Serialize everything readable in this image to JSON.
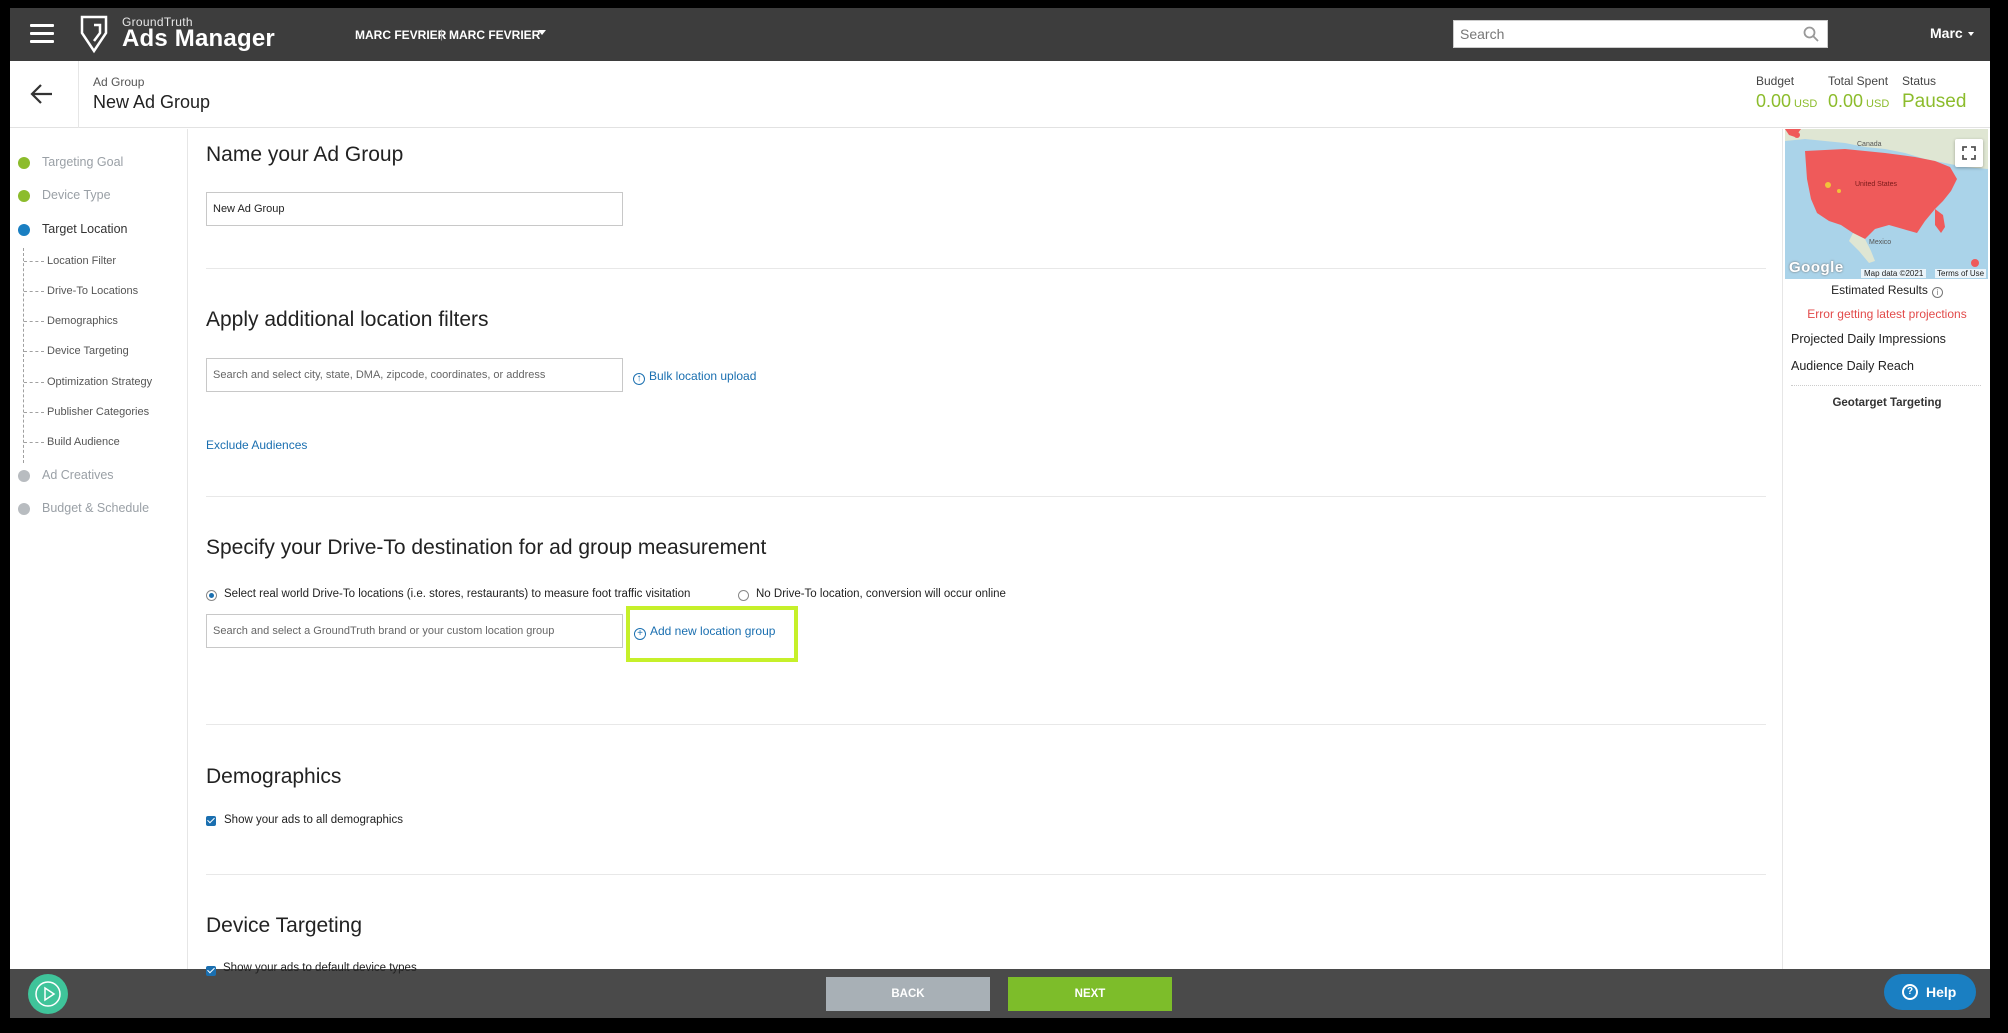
{
  "header": {
    "brand_small": "GroundTruth",
    "brand_main": "Ads Manager",
    "account_primary": "MARC FEVRIER",
    "account_secondary": "MARC FEVRIER",
    "search_placeholder": "Search",
    "user": "Marc"
  },
  "subheader": {
    "crumb": "Ad Group",
    "title": "New Ad Group",
    "budget_label": "Budget",
    "budget_value": "0.00",
    "budget_unit": "USD",
    "spent_label": "Total Spent",
    "spent_value": "0.00",
    "spent_unit": "USD",
    "status_label": "Status",
    "status_value": "Paused"
  },
  "stepper": {
    "steps": [
      {
        "label": "Targeting Goal",
        "state": "done"
      },
      {
        "label": "Device Type",
        "state": "done"
      },
      {
        "label": "Target Location",
        "state": "active"
      },
      {
        "label": "Ad Creatives",
        "state": "todo"
      },
      {
        "label": "Budget & Schedule",
        "state": "todo"
      }
    ],
    "substeps": [
      "Location Filter",
      "Drive-To Locations",
      "Demographics",
      "Device Targeting",
      "Optimization Strategy",
      "Publisher Categories",
      "Build Audience"
    ]
  },
  "main": {
    "name_section": {
      "title": "Name your Ad Group",
      "value": "New Ad Group"
    },
    "location_section": {
      "title": "Apply additional location filters",
      "placeholder": "Search and select city, state, DMA, zipcode, coordinates, or address",
      "bulk_link": "Bulk location upload",
      "exclude_link": "Exclude Audiences"
    },
    "driveto_section": {
      "title": "Specify your Drive-To destination for ad group measurement",
      "radio_real": "Select real world Drive-To locations (i.e. stores, restaurants) to measure foot traffic visitation",
      "radio_none": "No Drive-To location, conversion will occur online",
      "placeholder": "Search and select a GroundTruth brand or your custom location group",
      "add_link": "Add new location group"
    },
    "demographics_section": {
      "title": "Demographics",
      "checkbox": "Show your ads to all demographics"
    },
    "device_section": {
      "title": "Device Targeting",
      "checkbox": "Show your ads to default device types"
    }
  },
  "right_panel": {
    "map_labels": {
      "canada": "Canada",
      "us": "United States",
      "mexico": "Mexico"
    },
    "map_logo": "Google",
    "map_data": "Map data ©2021",
    "map_terms": "Terms of Use",
    "estimated_results": "Estimated Results",
    "error": "Error getting latest projections",
    "projected_impressions": "Projected Daily Impressions",
    "audience_reach": "Audience Daily Reach",
    "geotarget": "Geotarget Targeting"
  },
  "footer": {
    "back_label": "BACK",
    "next_label": "NEXT",
    "help_label": "Help"
  },
  "colors": {
    "accent_green": "#8cbc2c",
    "active_blue": "#1a7fc2",
    "error_red": "#e24a4a",
    "highlight": "#c6f02a"
  }
}
